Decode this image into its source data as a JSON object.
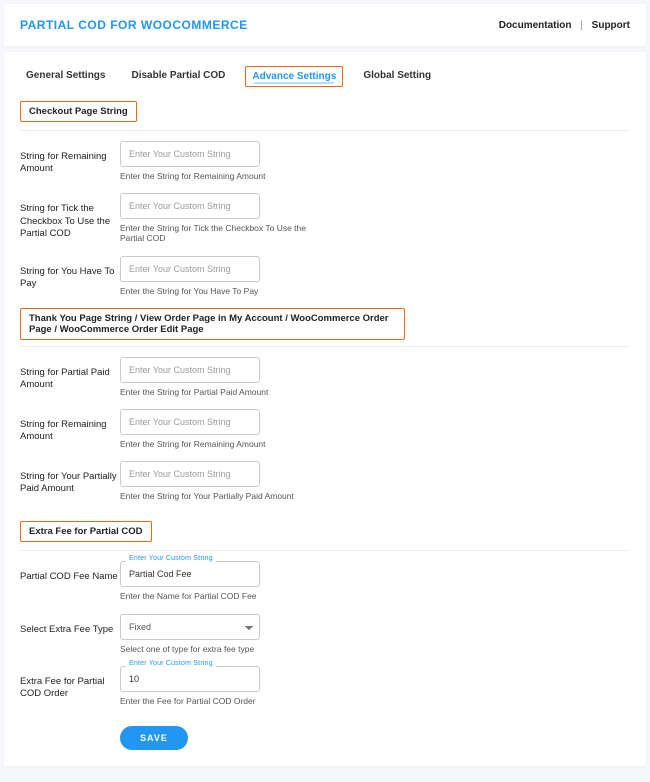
{
  "header": {
    "title": "PARTIAL COD FOR WOOCOMMERCE",
    "links": {
      "documentation": "Documentation",
      "support": "Support"
    }
  },
  "tabs": [
    {
      "id": "general",
      "label": "General Settings",
      "active": false
    },
    {
      "id": "disable",
      "label": "Disable Partial COD",
      "active": false
    },
    {
      "id": "advance",
      "label": "Advance Settings",
      "active": true
    },
    {
      "id": "global",
      "label": "Global Setting",
      "active": false
    }
  ],
  "sections": {
    "checkout": {
      "title": "Checkout Page String",
      "fields": [
        {
          "key": "remain",
          "label": "String for Remaining Amount",
          "placeholder": "Enter Your Custom String",
          "value": "",
          "helper": "Enter the String for Remaining Amount"
        },
        {
          "key": "tick",
          "label": "String for Tick the Checkbox To Use the Partial COD",
          "placeholder": "Enter Your Custom String",
          "value": "",
          "helper": "Enter the String for Tick the Checkbox To Use the Partial COD"
        },
        {
          "key": "youpay",
          "label": "String for You Have To Pay",
          "placeholder": "Enter Your Custom String",
          "value": "",
          "helper": "Enter the String for You Have To Pay"
        }
      ]
    },
    "thankyou": {
      "title": "Thank You Page String / View Order Page in My Account / WooCommerce Order Page / WooCommerce Order Edit Page",
      "fields": [
        {
          "key": "ppaid",
          "label": "String for Partial Paid Amount",
          "placeholder": "Enter Your Custom String",
          "value": "",
          "helper": "Enter the String for Partial Paid Amount"
        },
        {
          "key": "remain2",
          "label": "String for Remaining Amount",
          "placeholder": "Enter Your Custom String",
          "value": "",
          "helper": "Enter the String for Remaining Amount"
        },
        {
          "key": "ypp",
          "label": "String for Your Partially Paid Amount",
          "placeholder": "Enter Your Custom String",
          "value": "",
          "helper": "Enter the String for Your Partially Paid Amount"
        }
      ]
    },
    "extra": {
      "title": "Extra Fee for Partial COD",
      "fee_name": {
        "label": "Partial COD Fee Name",
        "float": "Enter Your Custom String",
        "value": "Partial Cod Fee",
        "helper": "Enter the Name for Partial COD Fee"
      },
      "fee_type": {
        "label": "Select Extra Fee Type",
        "value": "Fixed",
        "options": [
          "Fixed"
        ],
        "helper": "Select one of type for extra fee type"
      },
      "fee_value": {
        "label": "Extra Fee for Partial COD Order",
        "float": "Enter Your Custom String",
        "value": "10",
        "helper": "Enter the Fee for Partial COD Order"
      }
    }
  },
  "actions": {
    "save": "SAVE"
  }
}
